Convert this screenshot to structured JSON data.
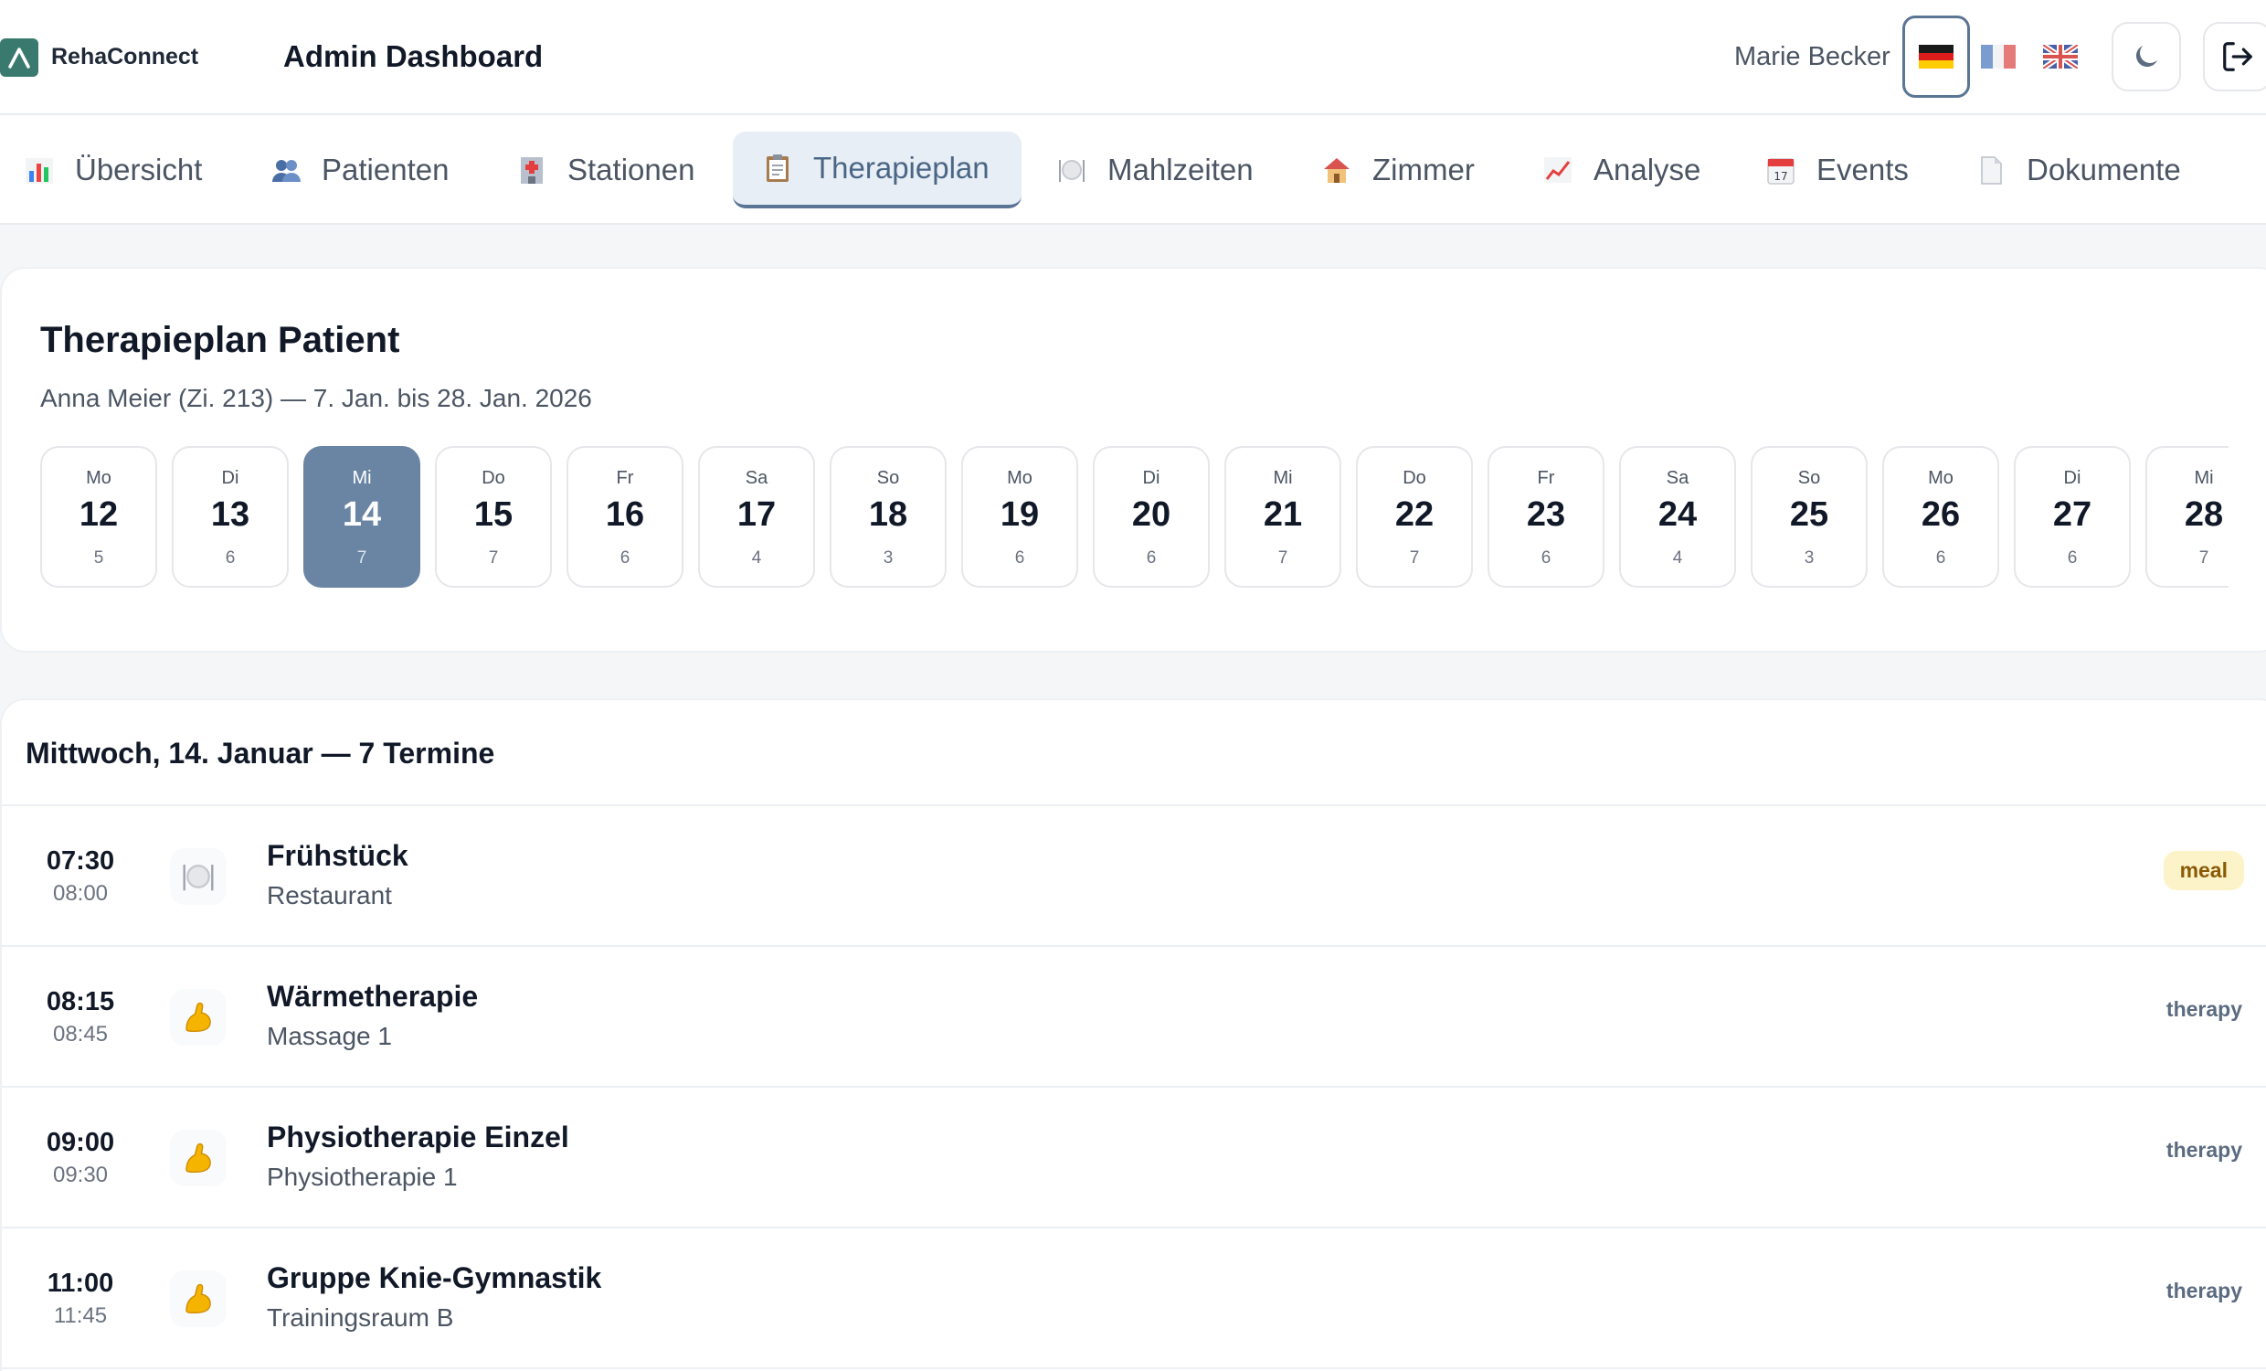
{
  "header": {
    "brand": "RehaConnect",
    "title": "Admin Dashboard",
    "user_name": "Marie Becker",
    "languages": [
      "de",
      "fr",
      "en"
    ],
    "active_language": "de",
    "accent_color": "#5b7594",
    "brand_color": "#3a7a6e"
  },
  "tabs": [
    {
      "label": "Übersicht",
      "icon": "bar-chart-icon"
    },
    {
      "label": "Patienten",
      "icon": "users-icon"
    },
    {
      "label": "Stationen",
      "icon": "hospital-icon"
    },
    {
      "label": "Therapieplan",
      "icon": "clipboard-icon",
      "active": true
    },
    {
      "label": "Mahlzeiten",
      "icon": "plate-icon"
    },
    {
      "label": "Zimmer",
      "icon": "house-icon"
    },
    {
      "label": "Analyse",
      "icon": "line-chart-icon"
    },
    {
      "label": "Events",
      "icon": "calendar-icon"
    },
    {
      "label": "Dokumente",
      "icon": "document-icon"
    }
  ],
  "plan": {
    "title": "Therapieplan Patient",
    "subtitle": "Anna Meier (Zi. 213) — 7. Jan. bis 28. Jan. 2026",
    "days": [
      {
        "name": "Mo",
        "num": "12",
        "count": "5"
      },
      {
        "name": "Di",
        "num": "13",
        "count": "6"
      },
      {
        "name": "Mi",
        "num": "14",
        "count": "7",
        "selected": true
      },
      {
        "name": "Do",
        "num": "15",
        "count": "7"
      },
      {
        "name": "Fr",
        "num": "16",
        "count": "6"
      },
      {
        "name": "Sa",
        "num": "17",
        "count": "4"
      },
      {
        "name": "So",
        "num": "18",
        "count": "3"
      },
      {
        "name": "Mo",
        "num": "19",
        "count": "6"
      },
      {
        "name": "Di",
        "num": "20",
        "count": "6"
      },
      {
        "name": "Mi",
        "num": "21",
        "count": "7"
      },
      {
        "name": "Do",
        "num": "22",
        "count": "7"
      },
      {
        "name": "Fr",
        "num": "23",
        "count": "6"
      },
      {
        "name": "Sa",
        "num": "24",
        "count": "4"
      },
      {
        "name": "So",
        "num": "25",
        "count": "3"
      },
      {
        "name": "Mo",
        "num": "26",
        "count": "6"
      },
      {
        "name": "Di",
        "num": "27",
        "count": "6"
      },
      {
        "name": "Mi",
        "num": "28",
        "count": "7"
      }
    ]
  },
  "schedule": {
    "heading": "Mittwoch, 14. Januar — 7 Termine",
    "items": [
      {
        "start": "07:30",
        "end": "08:00",
        "title": "Frühstück",
        "location": "Restaurant",
        "type": "meal",
        "icon": "plate-icon"
      },
      {
        "start": "08:15",
        "end": "08:45",
        "title": "Wärmetherapie",
        "location": "Massage 1",
        "type": "therapy",
        "icon": "flexed-arm-icon"
      },
      {
        "start": "09:00",
        "end": "09:30",
        "title": "Physiotherapie Einzel",
        "location": "Physiotherapie 1",
        "type": "therapy",
        "icon": "flexed-arm-icon"
      },
      {
        "start": "11:00",
        "end": "11:45",
        "title": "Gruppe Knie-Gymnastik",
        "location": "Trainingsraum B",
        "type": "therapy",
        "icon": "flexed-arm-icon"
      }
    ]
  }
}
